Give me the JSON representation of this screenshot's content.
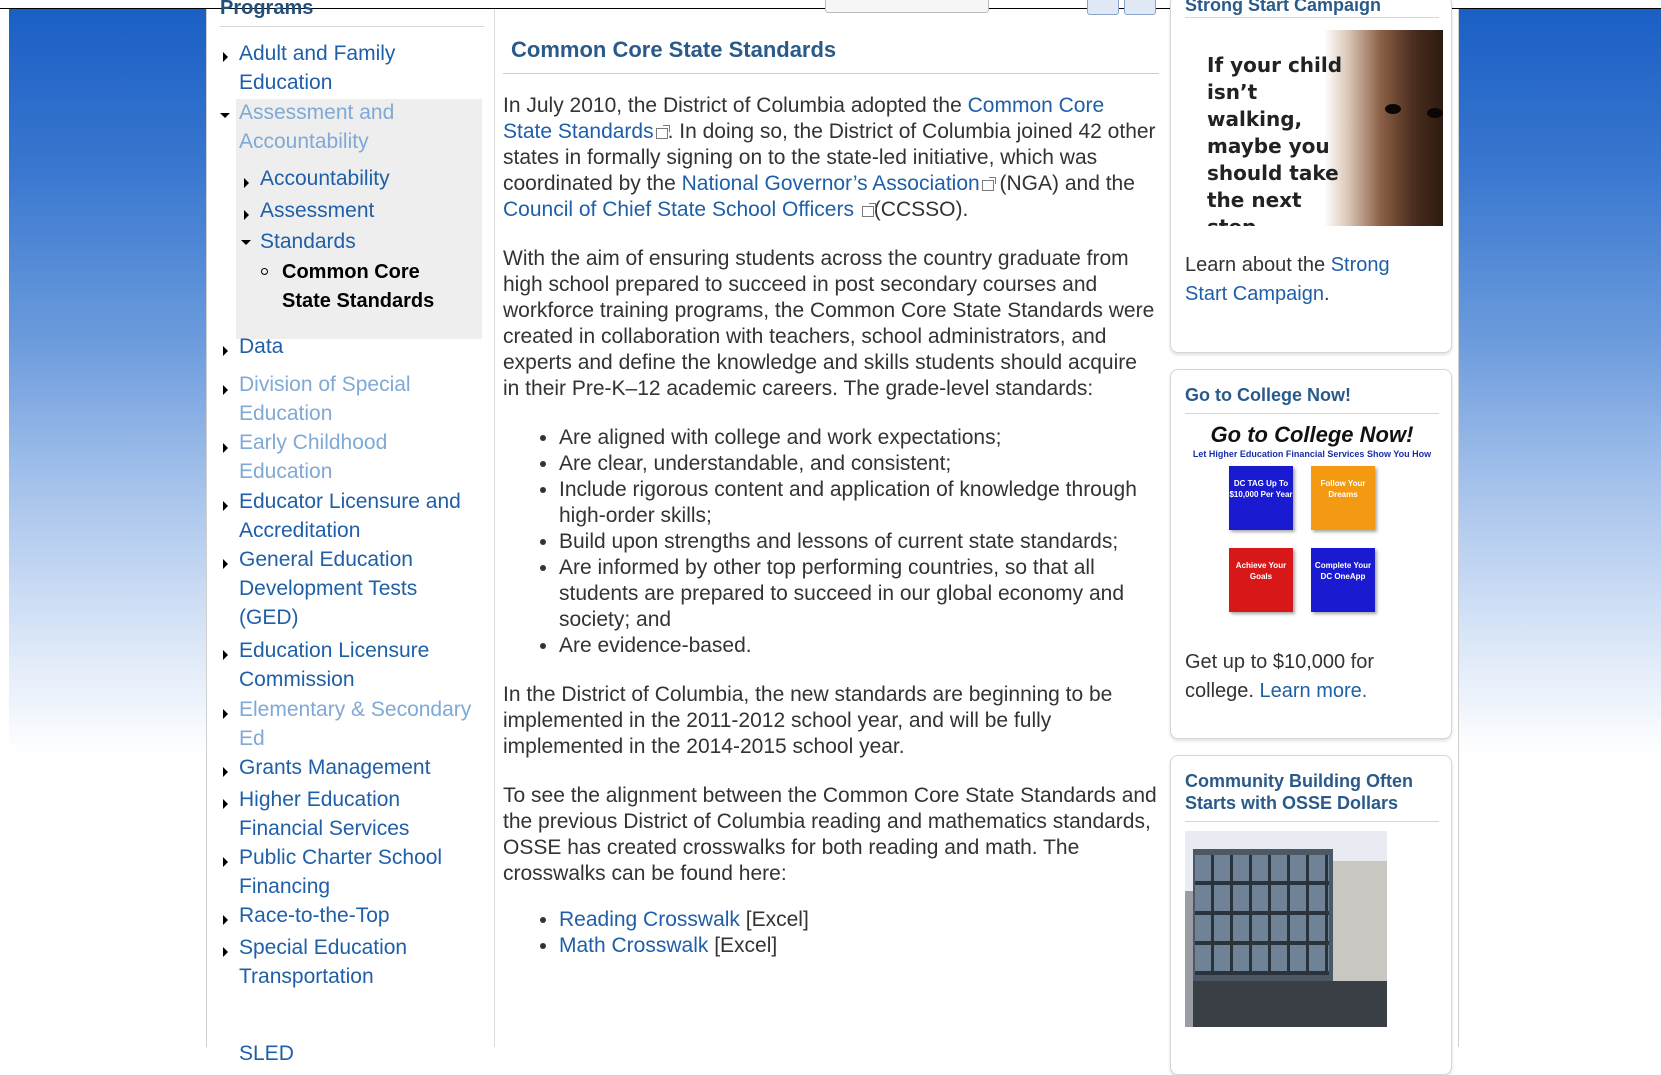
{
  "sidebar": {
    "title": "Programs",
    "items": [
      {
        "label": "Adult and Family Education"
      },
      {
        "label": "Assessment and Accountability"
      },
      {
        "label": "Accountability"
      },
      {
        "label": "Assessment"
      },
      {
        "label": "Standards"
      },
      {
        "label": "Common Core State Standards"
      },
      {
        "label": "Data"
      },
      {
        "label": "Division of Special Education"
      },
      {
        "label": "Early Childhood Education"
      },
      {
        "label": "Educator Licensure and Accreditation"
      },
      {
        "label": "General Education Development Tests (GED)"
      },
      {
        "label": "Education Licensure Commission"
      },
      {
        "label": "Elementary & Secondary Ed"
      },
      {
        "label": "Grants Management"
      },
      {
        "label": "Higher Education Financial Services"
      },
      {
        "label": "Public Charter School Financing"
      },
      {
        "label": "Race-to-the-Top"
      },
      {
        "label": "Special Education Transportation"
      },
      {
        "label": "SLED"
      }
    ]
  },
  "main": {
    "title": "Common Core State Standards",
    "p1": {
      "a": "In July 2010, the District of Columbia adopted the ",
      "link1": "Common Core State Standards",
      "b": ". In doing so, the District of Columbia joined 42 other states in formally signing on to the state-led initiative, which was coordinated by the ",
      "link2": "National Governor’s Association",
      "c": " (NGA) and the ",
      "link3": "Council of Chief State School Officers ",
      "d": "(CCSSO)."
    },
    "p2": "With the aim of ensuring students across the country graduate from high school prepared to succeed in post secondary courses and workforce training programs, the Common Core State Standards were created in collaboration with teachers, school administrators, and experts and define the knowledge and skills students should acquire in their Pre-K–12 academic careers. The grade-level standards:",
    "bullets": [
      "Are aligned with college and work expectations;",
      "Are clear, understandable, and consistent;",
      "Include rigorous content and application of knowledge through high-order skills;",
      "Build upon strengths and lessons of current state standards;",
      "Are informed by other top performing countries, so that all students are prepared to succeed in our global economy and society; and",
      "Are evidence-based."
    ],
    "p3": "In the District of Columbia, the new standards are beginning to be implemented in the 2011-2012 school year, and will be fully implemented in the 2014-2015 school year.",
    "p4": "To see the alignment between the Common Core State Standards and the previous District of Columbia reading and mathematics standards, OSSE has created crosswalks for both reading and math.  The crosswalks can be found here:",
    "downloads": [
      {
        "link": "Reading Crosswalk",
        "suffix": " [Excel]"
      },
      {
        "link": "Math Crosswalk",
        "suffix": " [Excel]"
      }
    ]
  },
  "right": {
    "strong_start": {
      "title": "Strong Start Campaign",
      "image_text": "If your child isn’t walking, maybe you should take the next step.",
      "text": "Learn about the ",
      "link": "Strong Start Campaign",
      "after": "."
    },
    "college": {
      "title": "Go to College Now!",
      "image_header": "Go to College Now!",
      "image_sub": "Let Higher Education Financial Services Show You How",
      "buttons": [
        {
          "label": "DC TAG Up To $10,000 Per Year",
          "color": "#1a1ad0"
        },
        {
          "label": "Follow Your Dreams",
          "color": "#f39a12"
        },
        {
          "label": "Achieve Your Goals",
          "color": "#d81818"
        },
        {
          "label": "Complete Your DC OneApp",
          "color": "#1a1ad0"
        }
      ],
      "text": "Get up to $10,000 for college.  ",
      "link": "Learn more."
    },
    "community": {
      "title": "Community Building Often Starts with OSSE Dollars"
    }
  },
  "colors": {
    "link": "#1f5fa8",
    "link_dim": "#7fa9d6",
    "heading": "#2a5a8a",
    "bg_blue": "#1a5fc4"
  }
}
